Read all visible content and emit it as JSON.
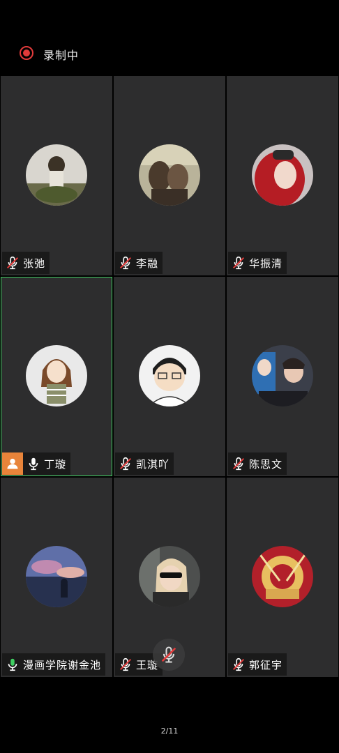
{
  "recording": {
    "label": "录制中",
    "color": "#e23b3b"
  },
  "participants": [
    {
      "name": "张弛",
      "mic": "muted",
      "avatar": "avatar-photo-1"
    },
    {
      "name": "李融",
      "mic": "muted",
      "avatar": "avatar-photo-2"
    },
    {
      "name": "华振清",
      "mic": "muted",
      "avatar": "avatar-photo-3"
    },
    {
      "name": "丁璇",
      "mic": "on",
      "host": true,
      "active": true,
      "avatar": "avatar-cartoon-1"
    },
    {
      "name": "凯淇吖",
      "mic": "muted",
      "avatar": "avatar-cartoon-2"
    },
    {
      "name": "陈思文",
      "mic": "muted",
      "avatar": "avatar-photo-4"
    },
    {
      "name": "漫画学院谢金池",
      "mic": "on",
      "avatar": "avatar-photo-5"
    },
    {
      "name": "王璇",
      "mic": "muted",
      "avatar": "avatar-photo-6"
    },
    {
      "name": "郭征宇",
      "mic": "muted",
      "avatar": "avatar-photo-7"
    }
  ],
  "pager": {
    "text": "2/11"
  },
  "colors": {
    "tile_bg": "#2d2d2e",
    "active_border": "#3fcf62",
    "host_badge": "#e8843a",
    "mic_on": "#3fcf62",
    "mic_muted": "#e23b3b"
  }
}
